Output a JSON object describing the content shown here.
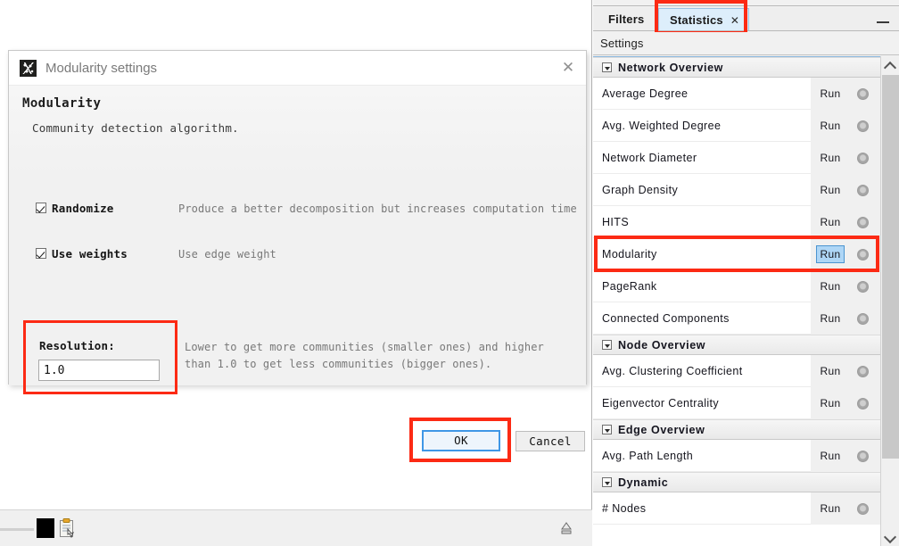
{
  "dialog": {
    "title": "Modularity settings",
    "app_icon": "gephi-app-icon",
    "close_icon": "close-icon",
    "heading": "Modularity",
    "subheading": "Community detection algorithm.",
    "checkboxes": [
      {
        "label": "Randomize",
        "description": "Produce a better decomposition but increases computation time",
        "checked": true
      },
      {
        "label": "Use weights",
        "description": "Use edge weight",
        "checked": true
      }
    ],
    "resolution": {
      "label": "Resolution:",
      "value": "1.0",
      "description": "Lower to get more communities (smaller ones) and higher\nthan 1.0 to get less communities (bigger ones)."
    },
    "buttons": {
      "ok": "OK",
      "cancel": "Cancel"
    }
  },
  "status_bar": {
    "color_swatch": "#000000",
    "clipboard_icon": "clipboard-icon",
    "eject_icon": "eject-icon"
  },
  "right_panel": {
    "tabs": [
      {
        "label": "Filters",
        "active": false
      },
      {
        "label": "Statistics",
        "active": true,
        "close_icon": "close-icon"
      }
    ],
    "minimize_icon": "minimize-icon",
    "settings_label": "Settings",
    "sections": [
      {
        "title": "Network Overview",
        "rows": [
          {
            "name": "Average Degree",
            "run": "Run",
            "run_active": false
          },
          {
            "name": "Avg. Weighted Degree",
            "run": "Run",
            "run_active": false
          },
          {
            "name": "Network Diameter",
            "run": "Run",
            "run_active": false
          },
          {
            "name": "Graph Density",
            "run": "Run",
            "run_active": false
          },
          {
            "name": "HITS",
            "run": "Run",
            "run_active": false
          },
          {
            "name": "Modularity",
            "run": "Run",
            "run_active": true
          },
          {
            "name": "PageRank",
            "run": "Run",
            "run_active": false
          },
          {
            "name": "Connected Components",
            "run": "Run",
            "run_active": false
          }
        ]
      },
      {
        "title": "Node Overview",
        "rows": [
          {
            "name": "Avg. Clustering Coefficient",
            "run": "Run",
            "run_active": false
          },
          {
            "name": "Eigenvector Centrality",
            "run": "Run",
            "run_active": false
          }
        ]
      },
      {
        "title": "Edge Overview",
        "rows": [
          {
            "name": "Avg. Path Length",
            "run": "Run",
            "run_active": false
          }
        ]
      },
      {
        "title": "Dynamic",
        "rows": [
          {
            "name": "# Nodes",
            "run": "Run",
            "run_active": false
          }
        ]
      }
    ]
  },
  "annotations": {
    "color": "#fc2a14",
    "targets": [
      "statistics-tab",
      "modularity-row",
      "resolution-field",
      "ok-button"
    ]
  }
}
